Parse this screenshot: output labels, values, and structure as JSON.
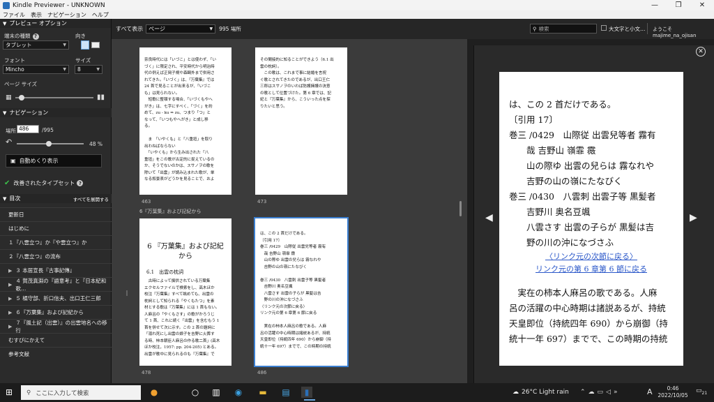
{
  "window": {
    "title": "Kindle Previewer - UNKNOWN"
  },
  "menu": [
    "ファイル",
    "表示",
    "ナビゲーション",
    "ヘルプ"
  ],
  "left": {
    "preview_options": "プレビュー オプション",
    "device_type_label": "端末の種類",
    "device_type_value": "タブレット",
    "orientation_label": "向き",
    "font_label": "フォント",
    "font_value": "Mincho",
    "size_label": "サイズ",
    "size_value": "8",
    "page_size_label": "ページ サイズ",
    "navigation": "ナビゲーション",
    "location_label": "場所",
    "location_value": "486",
    "location_total": "/995",
    "progress_percent": "48 %",
    "progress_fraction": 0.48,
    "autoflip_label": "自動めくり表示",
    "typeset_label": "改善されたタイプセット",
    "toc_label": "目次",
    "expand_all": "すべてを展開する",
    "toc_items": [
      {
        "label": "更新日",
        "arrow": ""
      },
      {
        "label": "はじめに",
        "arrow": ""
      },
      {
        "label": "１『八雲立つ』か『や雲立つ』か",
        "arrow": ""
      },
      {
        "label": "２『八雲立つ』の流布",
        "arrow": ""
      },
      {
        "label": "３ 本居宣長『古事記傳』",
        "arrow": "▶"
      },
      {
        "label": "４ 賀茂真淵の『語意考』と『日本紀和歌…",
        "arrow": "▶"
      },
      {
        "label": "５ 橘守部、折口信夫、出口王仁三郎",
        "arrow": "▶"
      },
      {
        "label": "６『万葉集』および記紀から",
        "arrow": "▶"
      },
      {
        "label": "７『風土記（出雲）』の出雲地名への移行",
        "arrow": "▶"
      },
      {
        "label": "むすびにかえて",
        "arrow": ""
      },
      {
        "label": "参考文献",
        "arrow": ""
      }
    ]
  },
  "toolbar": {
    "view_all_label": "すべて表示",
    "view_mode": "ページ",
    "location_count": "995 場所",
    "search_placeholder": "検索",
    "case_option": "大文字と小文…",
    "welcome": "ようこそ",
    "user": "majime_na_ojisan"
  },
  "center": {
    "section_label": "6『万葉集』および記紀から",
    "page_nums": [
      "463",
      "473",
      "478",
      "486"
    ],
    "page1": [
      "奈良時代には「いづこ」とは使わず、「い",
      "づく」に限定され、平安時代から明治時",
      "代の例えば正岡子規や森鷗外まで併用さ",
      "れてきた。「いづく」は、『万葉集』では",
      "24 首で見ることが出来るが、「いづこ",
      "も」は見られない。",
      "　短歌に整頓する場合、「いづくもやへ",
      "がき」は、七字にすべく、「づく」を約",
      "めて、zu - ku ⇒ zu、つまり「つ」と",
      "なって、「いつもやへがき」と成し移",
      "る。",
      "",
      "　ま　「いやくも」と「八重垣」を取り",
      "出わねばならない",
      "　「いやくも」から生み出された「八",
      "重垣」をこの歌が古定的に捉えているの",
      "か、そうでないのかは、スサノヲの歌を",
      "除いて「出雲」が読み込まれた歌が、単",
      "なる叙景表がどうかを見ることで、およ"
    ],
    "page2": [
      "その間接的に知ることができよう（6.1 出",
      "雲の枕詞）。",
      "　この歌は、これまで事に結婚を言祝",
      "ぐ歌とされてきたのであるが、出口王仁",
      "三郎はスサノヲのいわば防護擁護の決意",
      "の歌として位置づけた。第 6 章では、記",
      "紀と『万葉集』から、こういった点を探",
      "りたいと思う。"
    ],
    "page3_title": "6 『万葉集』および記紀から",
    "page3_sub": "6.1　出雲の枕詞",
    "page3": [
      "　古時によって撰供されている万葉集",
      "エクセルファイルで検索をし、高木ほか",
      "校注『万葉集』すべて眺めても、出雲の",
      "枕詞として知られる「やくもたつ」を素",
      "材とする歌は『万葉集』には 1 首もない。",
      "人麻呂の「やくもさす」の歌がかろうじ",
      "て 1 首、これに続く「出雲」を含むもう 1",
      "首を併せて次に示す。この 2 首の題詞に",
      "「溺れ死にし出雲の娘子を吉野に火葬す",
      "る時、柿本朝臣人麻呂の作る歌二首」(高木",
      "ほか校注，1957: pp. 204-205) とある。",
      "出雲が歌中に見られるのも『万葉集』で"
    ],
    "page4": [
      "は、この 2 首だけである。",
      "〔引用 17〕",
      "巻三 /0429　山際従 出雲兒等者 霧有",
      "　哉 吉野山 嶺霏 霺",
      "　山の際ゆ 出雲の兒らは 霧なれや",
      "　吉野の山の嶺にたなびく",
      "",
      "巻三 /0430　八雲刺 出雲子等 黒髪者",
      "　吉野川 奥名豆颯",
      "　八雲さす 出雲の子らが 黒髪は吉",
      "　野の川の沖になづさふ",
      "〈リンク元の次節に戻る〉",
      "リンク元の第 6 章第 6 節に戻る",
      "",
      "　実在の柿本人麻呂の歌である。人麻",
      "呂の活躍の中心時期は諸説あるが、持統",
      "天皇即位（持統四年 690）から崩御（持",
      "統十一年 697）までで、この時期の持統"
    ]
  },
  "preview": {
    "lines": [
      "は、この 2 首だけである。",
      "〔引用 17〕",
      "巻三 /0429　山際従 出雲兒等者 霧有",
      "　　哉 吉野山 嶺霏 霺",
      "　　山の際ゆ 出雲の兒らは 霧なれや",
      "　　吉野の山の嶺にたなびく",
      "巻三 /0430　八雲刺 出雲子等 黒髪者",
      "　　吉野川 奥名豆颯",
      "　　八雲さす 出雲の子らが 黒髪は吉",
      "　　野の川の沖になづさふ"
    ],
    "link1": "〈リンク元の次節に戻る〉",
    "link2": "リンク元の第 6 章第 6 節に戻る",
    "body": [
      "　実在の柿本人麻呂の歌である。人麻",
      "呂の活躍の中心時期は諸説あるが、持統",
      "天皇即位（持統四年 690）から崩御（持",
      "統十一年 697）までで、この時期の持統"
    ]
  },
  "taskbar": {
    "search_placeholder": "ここに入力して検索",
    "weather": "26°C  Light rain",
    "ime": "A",
    "time": "0:46",
    "date": "2022/10/05",
    "notif": "21"
  }
}
